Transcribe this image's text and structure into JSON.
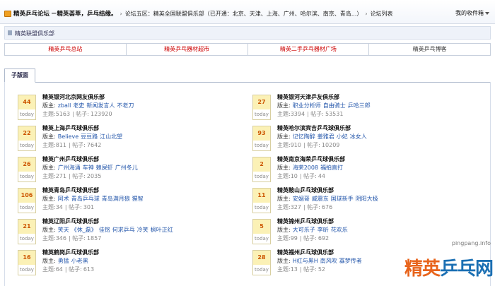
{
  "header": {
    "site_name": "精英乒乓论坛",
    "slogan": "－精英荟萃，乒乓结缘。",
    "crumb_sep1": "›",
    "crumb1": "论坛五区：精英全国联盟俱乐部（已开通：北京、天津、上海、广州、哈尔滨、南京、青岛...）",
    "crumb_sep2": "›",
    "crumb2": "论坛列表",
    "my_fav": "我的收件箱"
  },
  "forum_title": "精英联盟俱乐部",
  "links": [
    "精英乒乓总站",
    "精英乒乓器材超市",
    "精英二手乒乓器材广场",
    "精英乒乓博客"
  ],
  "tab_label": "子版面",
  "today_label": "today",
  "watermark": {
    "url": "pingpang.info",
    "text_first": "精英",
    "text_rest": "乒乓网"
  },
  "forums": [
    {
      "count": "44",
      "name": "精英银河北京网友俱乐部",
      "mod_label": "版主:",
      "mods": [
        "zball",
        "老史",
        "新闻发言人",
        "不老刀"
      ],
      "topics_label": "主题:",
      "topics": "5163",
      "posts_label": "| 帖子:",
      "posts": "123920"
    },
    {
      "count": "27",
      "name": "精英银河天津乒友俱乐部",
      "mod_label": "版主:",
      "mods": [
        "职业分析师",
        "自由骑士",
        "乒哈三郎"
      ],
      "topics_label": "主题:",
      "topics": "3394",
      "posts_label": "| 帖子:",
      "posts": "53531"
    },
    {
      "count": "22",
      "name": "精英上海乒乓球俱乐部",
      "mod_label": "版主:",
      "mods": [
        "Believe",
        "豆豆路",
        "江山北望"
      ],
      "topics_label": "主题:",
      "topics": "811",
      "posts_label": "| 帖子:",
      "posts": "7642"
    },
    {
      "count": "93",
      "name": "精英哈尔滨宾吉乒乓球俱乐部",
      "mod_label": "版主:",
      "mods": [
        "记忆陶醉",
        "姜雅君",
        "小妃",
        "冰女人"
      ],
      "topics_label": "主题:",
      "topics": "910",
      "posts_label": "| 帖子:",
      "posts": "10209"
    },
    {
      "count": "26",
      "name": "精英广州乒乓球俱乐部",
      "mod_label": "版主:",
      "mods": [
        "广州海涌",
        "车神",
        "赖屎虾",
        "广州冬儿"
      ],
      "topics_label": "主题:",
      "topics": "271",
      "posts_label": "| 帖子:",
      "posts": "2035"
    },
    {
      "count": "2",
      "name": "精英南京海荣乒乓球俱乐部",
      "mod_label": "版主:",
      "mods": [
        "海荣2008",
        "福拍直打"
      ],
      "topics_label": "主题:",
      "topics": "10",
      "posts_label": "| 帖子:",
      "posts": "44"
    },
    {
      "count": "106",
      "name": "精英青岛乒乓球俱乐部",
      "mod_label": "版主:",
      "mods": [
        "阿术",
        "青岛乒乓球",
        "青岛满月狼",
        "猩智"
      ],
      "topics_label": "主题:",
      "topics": "34",
      "posts_label": "| 帖子:",
      "posts": "301"
    },
    {
      "count": "11",
      "name": "精英鞍山乒乓球俱乐部",
      "mod_label": "版主:",
      "mods": [
        "安姻哥",
        "威震东",
        "国球新手",
        "阴阳大极"
      ],
      "topics_label": "主题:",
      "topics": "327",
      "posts_label": "| 帖子:",
      "posts": "676"
    },
    {
      "count": "21",
      "name": "精英辽阳乒乓球俱乐部",
      "mod_label": "版主:",
      "mods": [
        "笑天",
        "《休_磊》",
        "佳铭",
        "何求乒乓",
        "冷笑",
        "枫叶正红"
      ],
      "topics_label": "主题:",
      "topics": "346",
      "posts_label": "| 帖子:",
      "posts": "1857"
    },
    {
      "count": "5",
      "name": "精英锦州乒乓球俱乐部",
      "mod_label": "版主:",
      "mods": [
        "大可乐子",
        "李昕",
        "花欢乐"
      ],
      "topics_label": "主题:",
      "topics": "99",
      "posts_label": "| 帖子:",
      "posts": "692"
    },
    {
      "count": "16",
      "name": "精英鹤岗乒乓球俱乐部",
      "mod_label": "版主:",
      "mods": [
        "勇猛",
        "小老黑"
      ],
      "topics_label": "主题:",
      "topics": "64",
      "posts_label": "| 帖子:",
      "posts": "613"
    },
    {
      "count": "28",
      "name": "精英福州乒乓球俱乐部",
      "mod_label": "版主:",
      "mods": [
        "H红与黑H",
        "南风吹",
        "寡梦传者"
      ],
      "topics_label": "主题:",
      "topics": "13",
      "posts_label": "| 帖子:",
      "posts": "52"
    }
  ]
}
